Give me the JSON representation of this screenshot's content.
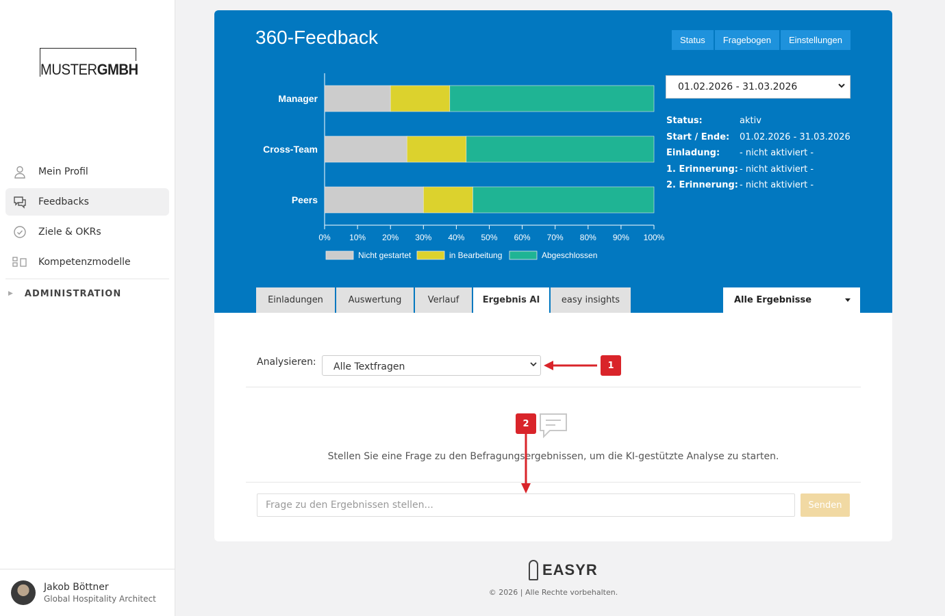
{
  "sidebar": {
    "logo": {
      "light": "MUSTER",
      "bold": "GMBH"
    },
    "items": [
      {
        "label": "Mein Profil",
        "icon": "user-icon"
      },
      {
        "label": "Feedbacks",
        "icon": "chat-icon",
        "active": true
      },
      {
        "label": "Ziele & OKRs",
        "icon": "check-circle-icon"
      },
      {
        "label": "Kompetenzmodelle",
        "icon": "grid-icon"
      }
    ],
    "admin_label": "ADMINISTRATION",
    "user": {
      "name": "Jakob Böttner",
      "role": "Global Hospitality Architect"
    }
  },
  "header": {
    "title": "360-Feedback",
    "buttons": [
      "Status",
      "Fragebogen",
      "Einstellungen"
    ],
    "date_range": "01.02.2026 - 31.03.2026",
    "info": [
      {
        "label": "Status:",
        "value": "aktiv"
      },
      {
        "label": "Start / Ende:",
        "value": "01.02.2026 - 31.03.2026"
      },
      {
        "label": "Einladung:",
        "value": "- nicht aktiviert -"
      },
      {
        "label": "1. Erinnerung:",
        "value": "- nicht aktiviert -"
      },
      {
        "label": "2. Erinnerung:",
        "value": "- nicht aktiviert -"
      }
    ]
  },
  "chart_data": {
    "type": "bar",
    "orientation": "horizontal",
    "stacked": true,
    "categories": [
      "Manager",
      "Cross-Team",
      "Peers"
    ],
    "series": [
      {
        "name": "Nicht gestartet",
        "color": "#cccccc",
        "values": [
          20,
          25,
          30
        ]
      },
      {
        "name": "in Bearbeitung",
        "color": "#dcd22d",
        "values": [
          18,
          18,
          15
        ]
      },
      {
        "name": "Abgeschlossen",
        "color": "#1fb494",
        "values": [
          62,
          57,
          55
        ]
      }
    ],
    "xlim": [
      0,
      100
    ],
    "xticks": [
      "0%",
      "10%",
      "20%",
      "30%",
      "40%",
      "50%",
      "60%",
      "70%",
      "80%",
      "90%",
      "100%"
    ],
    "legend_position": "bottom"
  },
  "tabs": [
    {
      "label": "Einladungen"
    },
    {
      "label": "Auswertung"
    },
    {
      "label": "Verlauf"
    },
    {
      "label": "Ergebnis AI",
      "active": true
    },
    {
      "label": "easy insights"
    }
  ],
  "filter": {
    "label": "Alle Ergebnisse"
  },
  "analysis": {
    "label": "Analysieren:",
    "selected": "Alle Textfragen",
    "hint": "Stellen Sie eine Frage zu den Befragungsergebnissen, um die KI-gestützte Analyse zu starten.",
    "input_placeholder": "Frage zu den Ergebnissen stellen...",
    "send_label": "Senden"
  },
  "annotations": [
    "1",
    "2"
  ],
  "footer": {
    "brand": "EASYR",
    "copyright": "© 2026 | Alle Rechte vorbehalten."
  }
}
